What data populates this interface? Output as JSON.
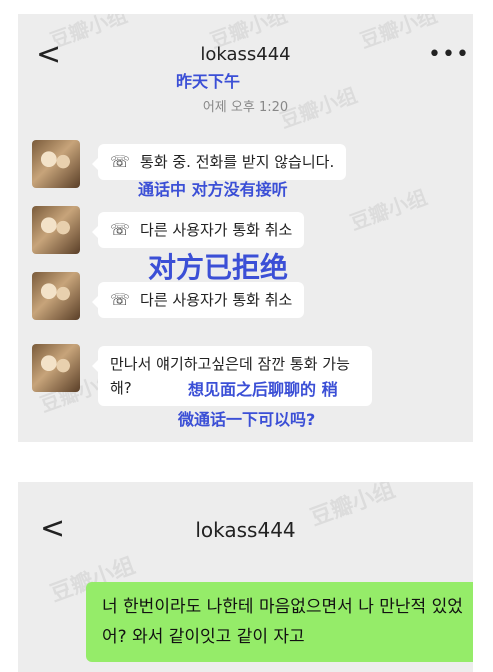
{
  "watermark": "豆瓣小组",
  "panel1": {
    "header": {
      "back": "<",
      "title": "lokass444",
      "more": "•••"
    },
    "overlay_yesterday": "昨天下午",
    "timestamp": "어제 오후 1:20",
    "messages": [
      {
        "text": "통화 중. 전화를 받지 않습니다.",
        "call": true
      },
      {
        "text": "다른 사용자가 통화 취소",
        "call": true
      },
      {
        "text": "다른 사용자가 통화 취소",
        "call": true
      },
      {
        "text": "만나서 얘기하고싶은데 잠깐 통화 가능해?",
        "call": false
      }
    ],
    "overlays": {
      "no_answer": "通话中 对方没有接听",
      "rejected": "对方已拒绝",
      "translation_line1": "想见面之后聊聊的 稍",
      "translation_line2": "微通话一下可以吗?"
    }
  },
  "panel2": {
    "header": {
      "back": "<",
      "title": "lokass444"
    },
    "message": "너 한번이라도 나한테 마음없으면서 나 만난적 있었어? 와서 같이잇고 같이 자고"
  },
  "icons": {
    "back": "chevron-left-icon",
    "more": "more-dots-icon",
    "call": "phone-handset-icon"
  },
  "colors": {
    "panel_bg": "#ededed",
    "bubble_white": "#ffffff",
    "bubble_green": "#95ec69",
    "overlay_blue": "#3b4fd6"
  }
}
